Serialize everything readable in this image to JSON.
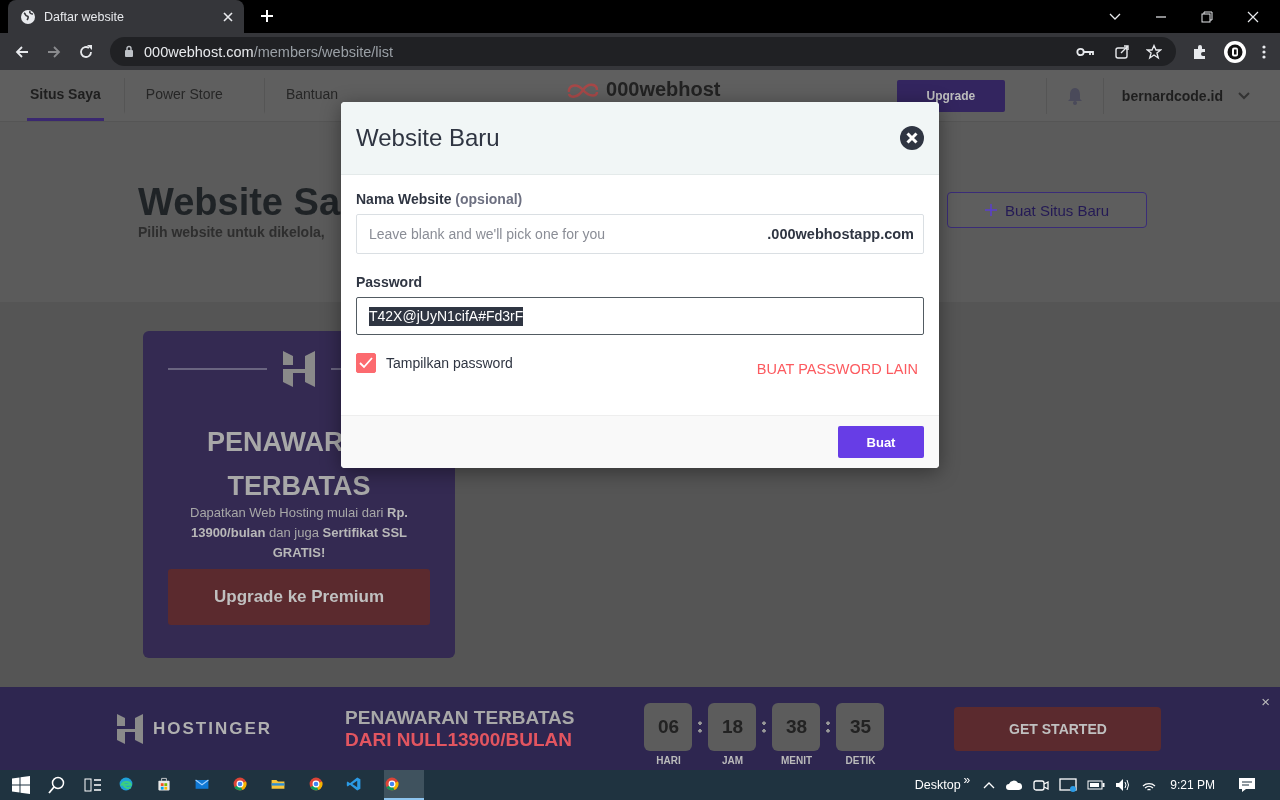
{
  "browser": {
    "tab_title": "Daftar website",
    "url_host": "000webhost.com",
    "url_path": "/members/website/list"
  },
  "nav": {
    "items": [
      {
        "label": "Situs Saya",
        "selected": true
      },
      {
        "label": "Power Store",
        "selected": false
      },
      {
        "label": "Bantuan",
        "selected": false
      }
    ],
    "logo": "000webhost",
    "upgrade_button": "Upgrade",
    "user": "bernardcode.id"
  },
  "hero": {
    "title": "Website Sa",
    "subtitle": "Pilih website untuk dikelola,",
    "create_button": "Buat Situs Baru"
  },
  "promo_card": {
    "heading": [
      "PENAWAR",
      "TERBATAS"
    ],
    "description": "Dapatkan Web Hosting mulai dari **Rp. 13900/bulan** dan juga **Sertifikat SSL GRATIS!**",
    "button": "Upgrade ke Premium"
  },
  "modal": {
    "title": "Website Baru",
    "name_label": "Nama Website",
    "name_hint": "(opsional)",
    "name_placeholder": "Leave blank and we'll pick one for you",
    "domain_suffix": ".000webhostapp.com",
    "password_label": "Password",
    "password_value": "T42X@jUyN1cifA#Fd3rF",
    "show_password": {
      "label": "Tampilkan password",
      "checked": true
    },
    "regenerate_link": "BUAT PASSWORD LAIN",
    "submit_button": "Buat"
  },
  "banner": {
    "brand": "HOSTINGER",
    "title": "PENAWARAN TERBATAS",
    "subtitle": "DARI NULL13900/BULAN",
    "countdown": [
      {
        "value": "06",
        "unit": "HARI"
      },
      {
        "value": "18",
        "unit": "JAM"
      },
      {
        "value": "38",
        "unit": "MENIT"
      },
      {
        "value": "35",
        "unit": "DETIK"
      }
    ],
    "cta_button": "GET STARTED",
    "close": "×"
  },
  "taskbar": {
    "apps": [
      {
        "kind": "edge",
        "selected": false
      },
      {
        "kind": "store",
        "selected": false
      },
      {
        "kind": "mail",
        "selected": false
      },
      {
        "kind": "chrome",
        "selected": false
      },
      {
        "kind": "folder",
        "selected": false
      },
      {
        "kind": "chrome",
        "selected": false
      },
      {
        "kind": "code",
        "selected": false
      },
      {
        "kind": "chrome",
        "selected": true
      }
    ],
    "desktop_label": "Desktop",
    "more": "»",
    "time": "9:21 PM"
  }
}
